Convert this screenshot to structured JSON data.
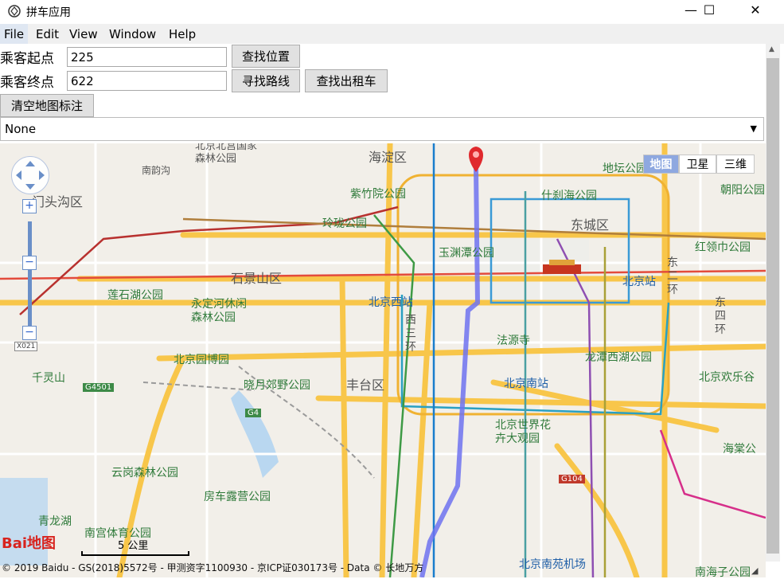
{
  "window": {
    "title": "拼车应用",
    "buttons": {
      "minimize": "—",
      "maximize": "☐",
      "close": "✕"
    }
  },
  "menu": [
    "File",
    "Edit",
    "View",
    "Window",
    "Help"
  ],
  "form": {
    "start_label": "乘客起点",
    "start_value": "225",
    "end_label": "乘客终点",
    "end_value": "622",
    "find_location": "查找位置",
    "find_route": "寻找路线",
    "find_taxi": "查找出租车",
    "clear_markers": "清空地图标注",
    "select_value": "None"
  },
  "map": {
    "type_buttons": [
      "地图",
      "卫星",
      "三维"
    ],
    "active_type": "地图",
    "zoom_in": "+",
    "zoom_out": "−",
    "scale": "5 公里",
    "copyright": "© 2019 Baidu - GS(2018)5572号 - 甲测资字1100930 - 京ICP证030173号 - Data © 长地万方",
    "logo": "Bai地图",
    "labels": [
      "海淀区",
      "北京北宫国家森林公园",
      "南韵沟",
      "门头沟区",
      "紫竹院公园",
      "什刹海公园",
      "地坛公园",
      "朝阳公园",
      "玲珑公园",
      "东城区",
      "玉渊潭公园",
      "红领巾公园",
      "石景山区",
      "北京站",
      "莲石湖公园",
      "永定河休闲森林公园",
      "北京西站",
      "东二环",
      "东四环",
      "西三环",
      "法源寺",
      "北京园博园",
      "龙潭西湖公园",
      "千灵山",
      "晓月郊野公园",
      "丰台区",
      "北京南站",
      "北京欢乐谷",
      "北京世界花卉大观园",
      "海棠公",
      "云岗森林公园",
      "房车露营公园",
      "青龙湖",
      "南宫体育公园",
      "北京南苑机场",
      "南海子公园",
      "G4501",
      "G4",
      "G104",
      "X021"
    ]
  },
  "colors": {
    "route": "#6f72f0",
    "marker": "#e0292d",
    "road_major": "#f8c64a",
    "subway_blue": "#3a9ad6",
    "subway_red": "#e34b3c",
    "map_type_active": "#8ea8e0",
    "park": "#c8e6b6"
  }
}
